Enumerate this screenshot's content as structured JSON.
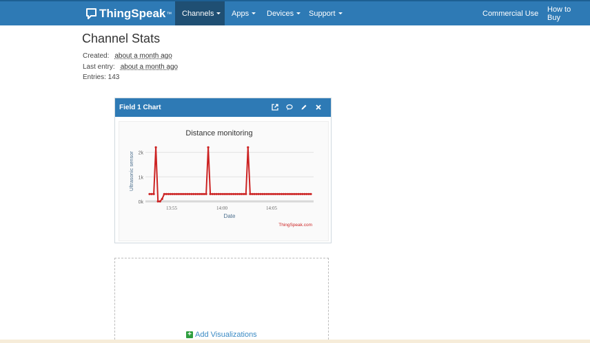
{
  "navbar": {
    "brand": "ThingSpeak",
    "brand_tm": "™",
    "items": [
      {
        "label": "Channels",
        "active": true
      },
      {
        "label": "Apps"
      },
      {
        "label": "Devices"
      },
      {
        "label": "Support"
      }
    ],
    "right_items": [
      "Commercial Use",
      "How to Buy"
    ],
    "color": "#2e7ab5"
  },
  "page": {
    "title": "Channel Stats",
    "created_label": "Created:",
    "created_value": "about a month ago",
    "last_entry_label": "Last entry:",
    "last_entry_value": "about a month ago",
    "entries": "Entries: 143"
  },
  "widget": {
    "title": "Field 1 Chart",
    "icons": [
      "external-link-icon",
      "comment-icon",
      "pencil-icon",
      "close-icon"
    ]
  },
  "chart_data": {
    "type": "line",
    "title": "Distance monitoring",
    "xlabel": "Date",
    "ylabel": "Ultrasonic sensor",
    "credit": "ThingSpeak.com",
    "x_tick_labels": [
      "13:55",
      "14:00",
      "14:05"
    ],
    "y_tick_labels": [
      "0k",
      "1k",
      "2k"
    ],
    "y_ticks": [
      0,
      1000,
      2000
    ],
    "ylim": [
      0,
      2100
    ],
    "series_color": "#cc2222",
    "series": [
      {
        "values": [
          300,
          300,
          300,
          2200,
          0,
          0,
          100,
          300,
          300,
          300,
          300,
          300,
          300,
          300,
          300,
          300,
          300,
          300,
          300,
          300,
          300,
          300,
          300,
          300,
          300,
          300,
          300,
          300,
          2200,
          300,
          300,
          300,
          300,
          300,
          300,
          300,
          300,
          300,
          300,
          300,
          300,
          300,
          300,
          300,
          300,
          300,
          300,
          2200,
          300,
          300,
          300,
          300,
          300,
          300,
          300,
          300,
          300,
          300,
          300,
          300,
          300,
          300,
          300,
          300,
          300,
          300,
          300,
          300,
          300,
          300,
          300,
          300,
          300,
          300,
          300,
          300,
          300,
          300
        ]
      }
    ],
    "grid": true
  },
  "add_viz": {
    "label": "Add Visualizations"
  }
}
